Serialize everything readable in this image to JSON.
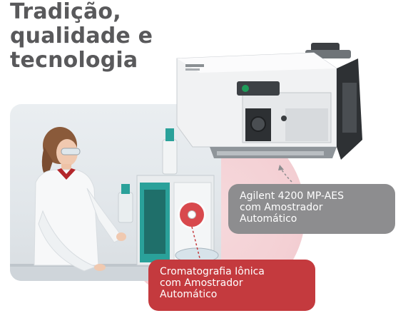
{
  "headline": {
    "lines": [
      "Tradição,",
      "qualidade e",
      "tecnologia"
    ]
  },
  "callouts": {
    "mp_aes": {
      "lines": [
        "Agilent 4200 MP-AES",
        "com Amostrador",
        "Automático"
      ]
    },
    "ion_chromatography": {
      "lines": [
        "Cromatografia Iônica",
        "com Amostrador",
        "Automático"
      ]
    }
  },
  "colors": {
    "headline": "#59595b",
    "callout_gray": "#8d8d8f",
    "callout_red": "#c43a3e",
    "pink_circle": "#f4d1d5"
  },
  "icons": {
    "target_marker": "target-dot-icon"
  }
}
